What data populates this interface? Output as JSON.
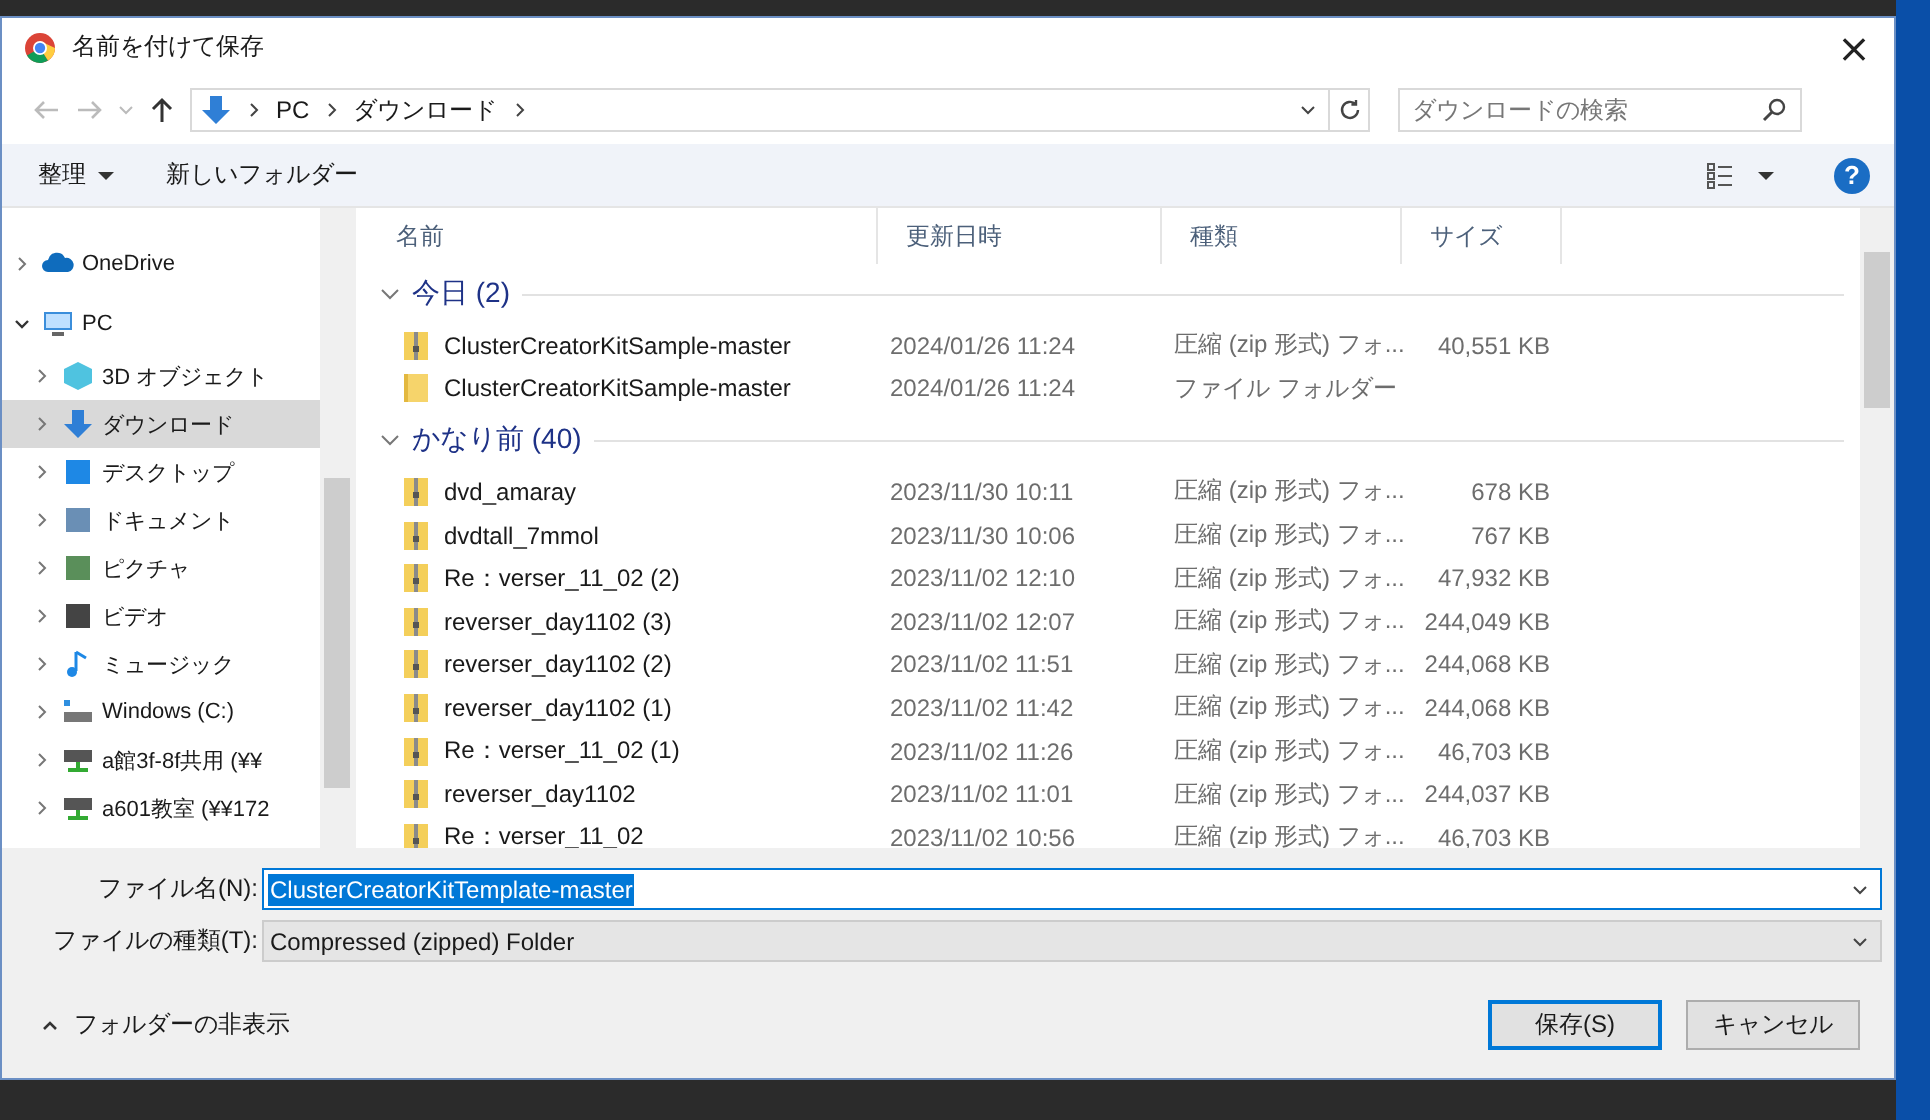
{
  "window": {
    "title": "名前を付けて保存",
    "close": "×"
  },
  "address": {
    "segments": [
      "PC",
      "ダウンロード"
    ]
  },
  "search": {
    "placeholder": "ダウンロードの検索"
  },
  "toolbar": {
    "organize": "整理",
    "new_folder": "新しいフォルダー",
    "help": "?"
  },
  "sidebar": {
    "items": [
      {
        "label": "OneDrive",
        "expanded": false,
        "selected": false
      },
      {
        "label": "PC",
        "expanded": true,
        "selected": false,
        "children": [
          {
            "label": "3D オブジェクト",
            "expanded": false,
            "selected": false
          },
          {
            "label": "ダウンロード",
            "expanded": false,
            "selected": true
          },
          {
            "label": "デスクトップ",
            "expanded": false,
            "selected": false
          },
          {
            "label": "ドキュメント",
            "expanded": false,
            "selected": false
          },
          {
            "label": "ピクチャ",
            "expanded": false,
            "selected": false
          },
          {
            "label": "ビデオ",
            "expanded": false,
            "selected": false
          },
          {
            "label": "ミュージック",
            "expanded": false,
            "selected": false
          },
          {
            "label": "Windows (C:)",
            "expanded": false,
            "selected": false
          },
          {
            "label": "a館3f-8f共用 (¥¥",
            "expanded": false,
            "selected": false
          },
          {
            "label": "a601教室 (¥¥172",
            "expanded": false,
            "selected": false
          }
        ]
      }
    ]
  },
  "table": {
    "columns": [
      "名前",
      "更新日時",
      "種類",
      "サイズ"
    ],
    "groups": [
      {
        "title": "今日 (2)",
        "expanded": true,
        "rows": [
          {
            "kind": "zip",
            "name": "ClusterCreatorKitSample-master",
            "date": "2024/01/26 11:24",
            "type": "圧縮 (zip 形式) フォ...",
            "size": "40,551 KB"
          },
          {
            "kind": "folder",
            "name": "ClusterCreatorKitSample-master",
            "date": "2024/01/26 11:24",
            "type": "ファイル フォルダー",
            "size": ""
          }
        ]
      },
      {
        "title": "かなり前 (40)",
        "expanded": true,
        "rows": [
          {
            "kind": "zip",
            "name": "dvd_amaray",
            "date": "2023/11/30 10:11",
            "type": "圧縮 (zip 形式) フォ...",
            "size": "678 KB"
          },
          {
            "kind": "zip",
            "name": "dvdtall_7mmol",
            "date": "2023/11/30 10:06",
            "type": "圧縮 (zip 形式) フォ...",
            "size": "767 KB"
          },
          {
            "kind": "zip",
            "name": "Re：verser_11_02 (2)",
            "date": "2023/11/02 12:10",
            "type": "圧縮 (zip 形式) フォ...",
            "size": "47,932 KB"
          },
          {
            "kind": "zip",
            "name": "reverser_day1102 (3)",
            "date": "2023/11/02 12:07",
            "type": "圧縮 (zip 形式) フォ...",
            "size": "244,049 KB"
          },
          {
            "kind": "zip",
            "name": "reverser_day1102 (2)",
            "date": "2023/11/02 11:51",
            "type": "圧縮 (zip 形式) フォ...",
            "size": "244,068 KB"
          },
          {
            "kind": "zip",
            "name": "reverser_day1102 (1)",
            "date": "2023/11/02 11:42",
            "type": "圧縮 (zip 形式) フォ...",
            "size": "244,068 KB"
          },
          {
            "kind": "zip",
            "name": "Re：verser_11_02 (1)",
            "date": "2023/11/02 11:26",
            "type": "圧縮 (zip 形式) フォ...",
            "size": "46,703 KB"
          },
          {
            "kind": "zip",
            "name": "reverser_day1102",
            "date": "2023/11/02 11:01",
            "type": "圧縮 (zip 形式) フォ...",
            "size": "244,037 KB"
          },
          {
            "kind": "zip",
            "name": "Re：verser_11_02",
            "date": "2023/11/02 10:56",
            "type": "圧縮 (zip 形式) フォ...",
            "size": "46,703 KB"
          }
        ]
      }
    ]
  },
  "file_name": {
    "label": "ファイル名(N):",
    "value": "ClusterCreatorKitTemplate-master",
    "value_selected": true
  },
  "file_type": {
    "label": "ファイルの種類(T):",
    "value": "Compressed (zipped) Folder"
  },
  "hide_folders": "フォルダーの非表示",
  "buttons": [
    {
      "label": "保存(S)",
      "kind": "primary"
    },
    {
      "label": "キャンセル",
      "kind": "normal"
    }
  ]
}
